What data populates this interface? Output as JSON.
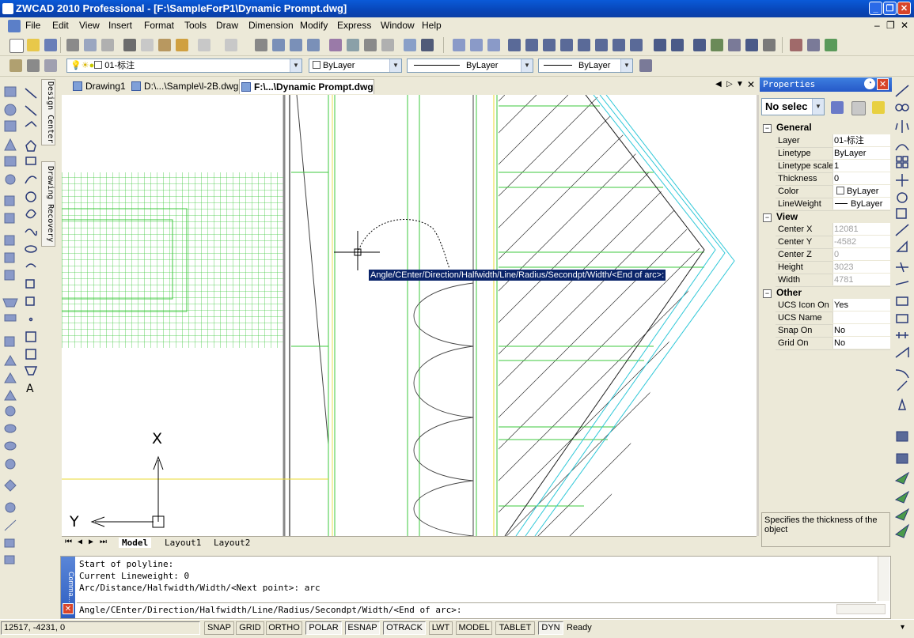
{
  "window": {
    "title": "ZWCAD 2010 Professional - [F:\\SampleForP1\\Dynamic Prompt.dwg]"
  },
  "menu": [
    "File",
    "Edit",
    "View",
    "Insert",
    "Format",
    "Tools",
    "Draw",
    "Dimension",
    "Modify",
    "Express",
    "Window",
    "Help"
  ],
  "layer_toolbar": {
    "layer": "01-标注",
    "color": "ByLayer",
    "linetype": "ByLayer",
    "lineweight": "ByLayer"
  },
  "side_tabs": {
    "design_center": "Design Center",
    "drawing_recovery": "Drawing Recovery"
  },
  "doc_tabs": [
    "Drawing1",
    "D:\\...\\Sample\\l-2B.dwg",
    "F:\\...\\Dynamic Prompt.dwg"
  ],
  "canvas": {
    "dynamic_prompt": "Angle/CEnter/Direction/Halfwidth/Line/Radius/Secondpt/Width/<End of arc>:",
    "ucs_x": "X",
    "ucs_y": "Y"
  },
  "layout_tabs": [
    "Model",
    "Layout1",
    "Layout2"
  ],
  "properties": {
    "title": "Properties",
    "selection": "No selec",
    "categories": {
      "general": "General",
      "view": "View",
      "other": "Other"
    },
    "general": [
      {
        "k": "Layer",
        "v": "01-标注"
      },
      {
        "k": "Linetype",
        "v": "ByLayer"
      },
      {
        "k": "Linetype scale",
        "v": "1"
      },
      {
        "k": "Thickness",
        "v": "0"
      },
      {
        "k": "Color",
        "v": "ByLayer"
      },
      {
        "k": "LineWeight",
        "v": "ByLayer"
      }
    ],
    "view": [
      {
        "k": "Center X",
        "v": "12081"
      },
      {
        "k": "Center Y",
        "v": "-4582"
      },
      {
        "k": "Center Z",
        "v": "0"
      },
      {
        "k": "Height",
        "v": "3023"
      },
      {
        "k": "Width",
        "v": "4781"
      }
    ],
    "other": [
      {
        "k": "UCS Icon On",
        "v": "Yes"
      },
      {
        "k": "UCS Name",
        "v": ""
      },
      {
        "k": "Snap On",
        "v": "No"
      },
      {
        "k": "Grid On",
        "v": "No"
      }
    ],
    "description": "Specifies the thickness of the object"
  },
  "command": {
    "label": "Comma...",
    "history": [
      "Start of polyline:",
      "Current Lineweight: 0",
      "Arc/Distance/Halfwidth/Width/<Next point>: arc"
    ],
    "input": "Angle/CEnter/Direction/Halfwidth/Line/Radius/Secondpt/Width/<End of arc>:"
  },
  "status": {
    "coords": "12517, -4231, 0",
    "buttons": [
      "SNAP",
      "GRID",
      "ORTHO",
      "POLAR",
      "ESNAP",
      "OTRACK",
      "LWT",
      "MODEL",
      "TABLET",
      "DYN"
    ],
    "ready": "Ready"
  }
}
